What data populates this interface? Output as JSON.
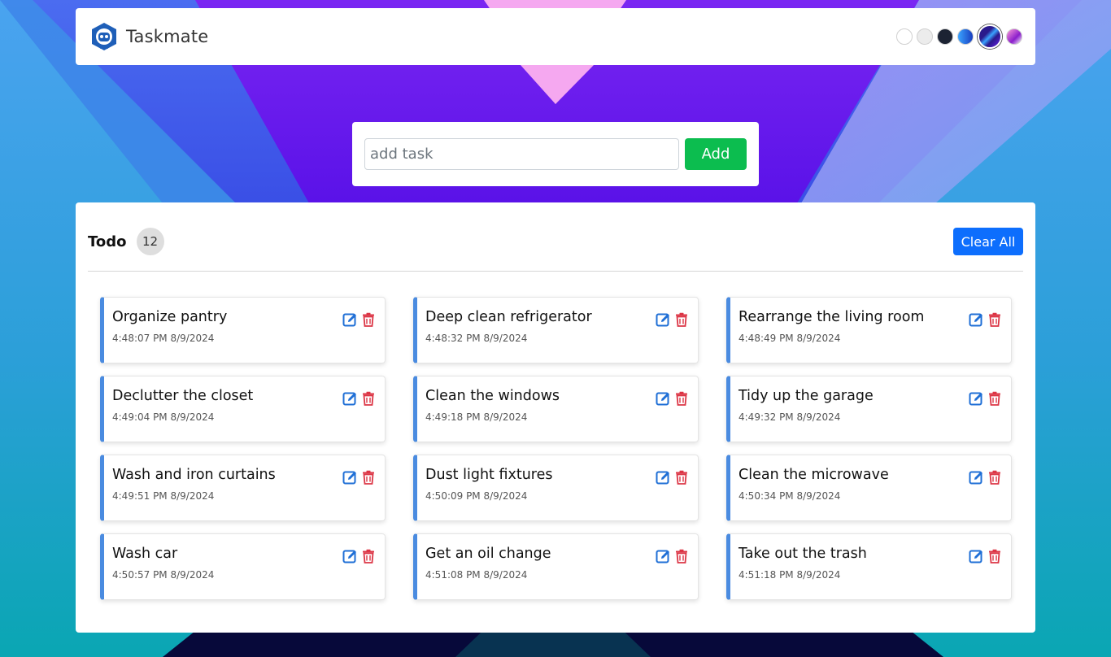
{
  "header": {
    "app_name": "Taskmate",
    "logo_icon": "robot-icon",
    "theme_swatches": [
      {
        "name": "light",
        "color": "#ffffff"
      },
      {
        "name": "grey",
        "color": "#ececec"
      },
      {
        "name": "dark",
        "color": "#1c2333"
      },
      {
        "name": "blue",
        "color": "#1f6fd6"
      },
      {
        "name": "purple-gradient",
        "color": "#5a1ee0",
        "active": true
      },
      {
        "name": "pink-gradient",
        "color": "#e060d0"
      }
    ]
  },
  "add_task": {
    "placeholder": "add task",
    "value": "",
    "button_label": "Add"
  },
  "todo": {
    "title": "Todo",
    "count": "12",
    "clear_label": "Clear All",
    "tasks": [
      {
        "text": "Organize pantry",
        "time": "4:48:07 PM 8/9/2024"
      },
      {
        "text": "Deep clean refrigerator",
        "time": "4:48:32 PM 8/9/2024"
      },
      {
        "text": "Rearrange the living room",
        "time": "4:48:49 PM 8/9/2024"
      },
      {
        "text": "Declutter the closet",
        "time": "4:49:04 PM 8/9/2024"
      },
      {
        "text": "Clean the windows",
        "time": "4:49:18 PM 8/9/2024"
      },
      {
        "text": "Tidy up the garage",
        "time": "4:49:32 PM 8/9/2024"
      },
      {
        "text": "Wash and iron curtains",
        "time": "4:49:51 PM 8/9/2024"
      },
      {
        "text": "Dust light fixtures",
        "time": "4:50:09 PM 8/9/2024"
      },
      {
        "text": "Clean the microwave",
        "time": "4:50:34 PM 8/9/2024"
      },
      {
        "text": "Wash car",
        "time": "4:50:57 PM 8/9/2024"
      },
      {
        "text": "Get an oil change",
        "time": "4:51:08 PM 8/9/2024"
      },
      {
        "text": "Take out the trash",
        "time": "4:51:18 PM 8/9/2024"
      }
    ],
    "edit_icon": "edit-icon",
    "delete_icon": "trash-icon"
  },
  "colors": {
    "accent": "#0d6efd",
    "add_button": "#0cbd4f",
    "task_border": "#4a8be0",
    "edit_icon": "#1f6fd6",
    "delete_icon": "#dc3545"
  }
}
